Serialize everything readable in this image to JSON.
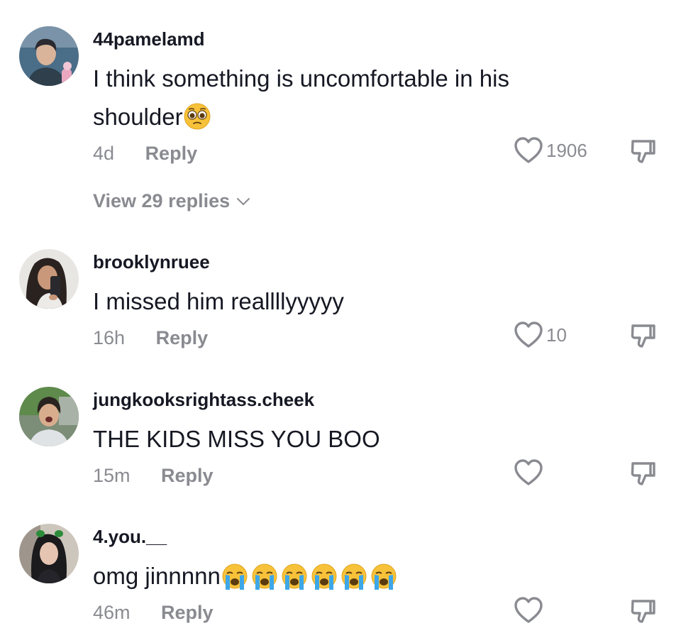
{
  "comments": [
    {
      "username": "44pamelamd",
      "text": "I think something is uncomfortable in his shoulder",
      "emojis": [
        "pleading-face"
      ],
      "time": "4d",
      "reply_label": "Reply",
      "likes": "1906",
      "view_replies": "View 29 replies"
    },
    {
      "username": "brooklynruee",
      "text": "I missed him reallllyyyyy",
      "time": "16h",
      "reply_label": "Reply",
      "likes": "10"
    },
    {
      "username": "jungkooksrightass.cheek",
      "text": "THE KIDS MISS YOU BOO",
      "time": "15m",
      "reply_label": "Reply"
    },
    {
      "username": "4.you.__",
      "text": "omg jinnnnn",
      "emojis": [
        "loudly-crying-face",
        "loudly-crying-face",
        "loudly-crying-face",
        "loudly-crying-face",
        "loudly-crying-face",
        "loudly-crying-face"
      ],
      "time": "46m",
      "reply_label": "Reply"
    }
  ],
  "colors": {
    "text": "#161823",
    "muted": "#8a8b91",
    "emoji_yellow": "#f7c23a"
  }
}
